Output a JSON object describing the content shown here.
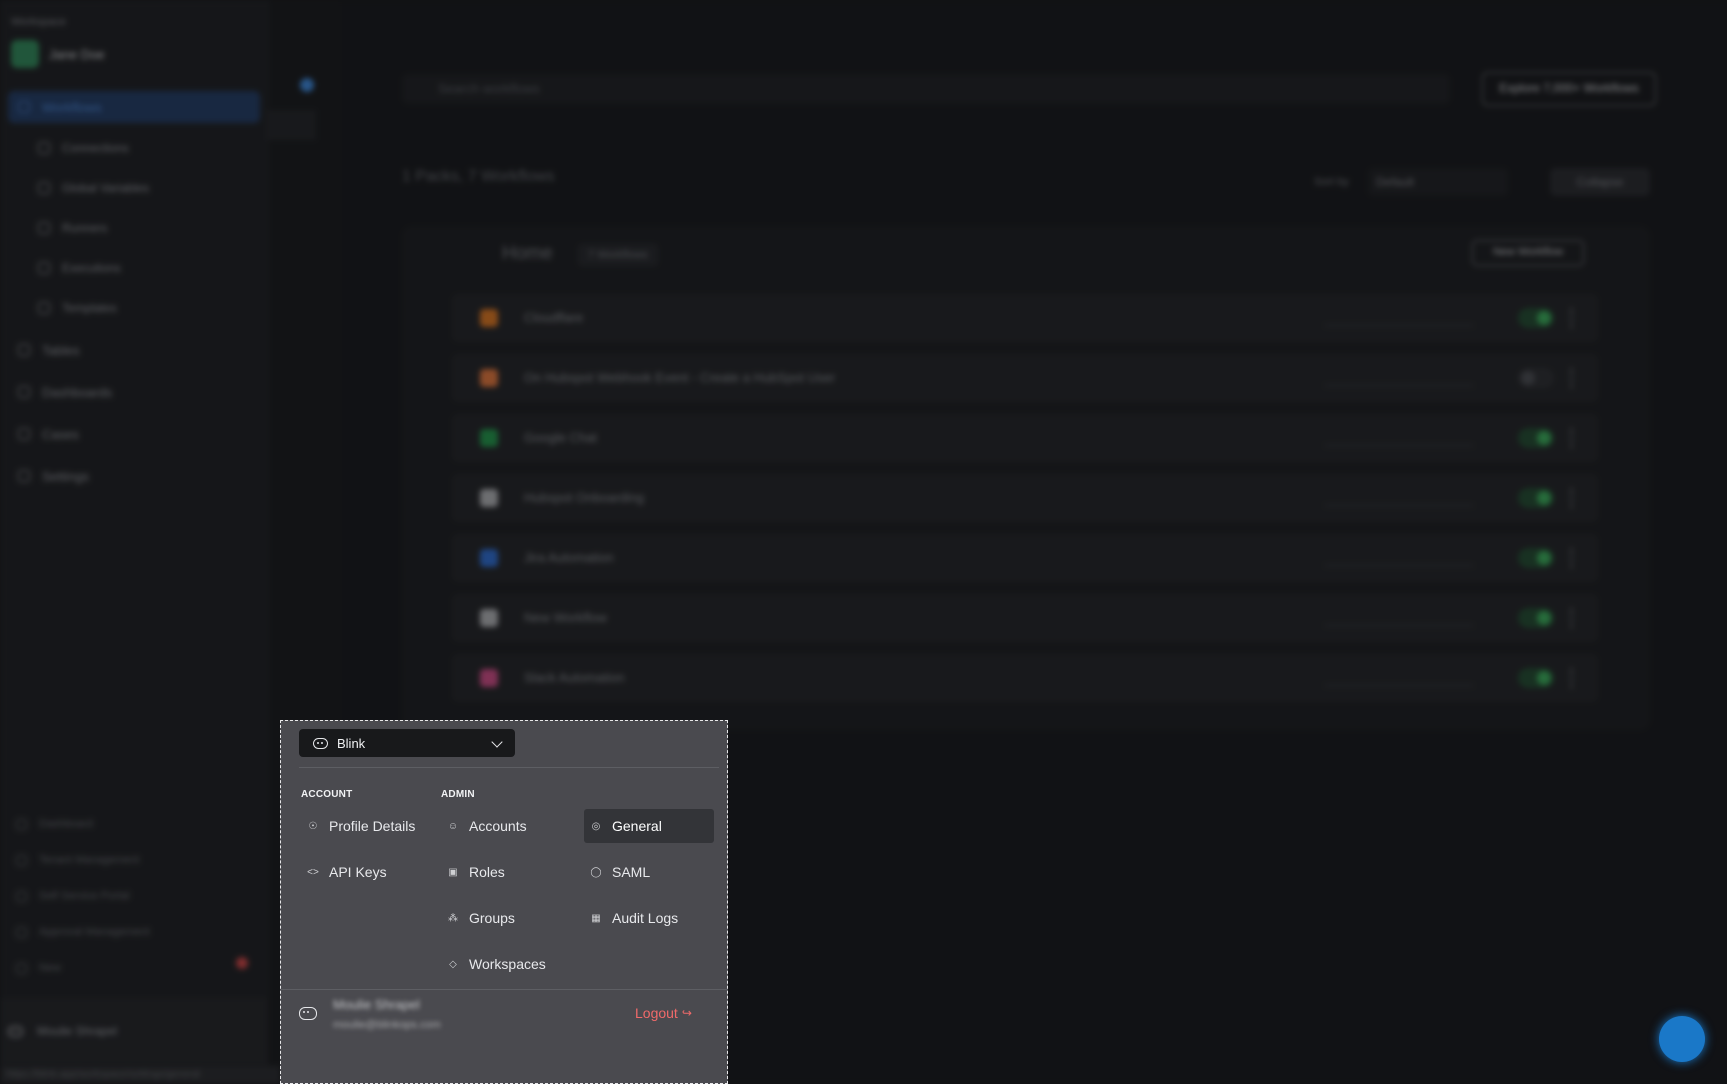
{
  "background": {
    "workspace_label": "Workspace",
    "workspace_name": "Jane Doe",
    "nav": [
      "Workflows",
      "Connections",
      "Global Variables",
      "Runners",
      "Executions",
      "Templates",
      "Tables",
      "Dashboards",
      "Cases",
      "Settings"
    ],
    "search_placeholder": "Search workflows",
    "explore_button": "Explore 7,000+ Workflows",
    "count_text": "1 Packs, 7 Workflows",
    "sort_label": "Sort by",
    "sort_value": "Default",
    "collapse_button": "Collapse",
    "pack_title": "Home",
    "pack_badge": "7 Workflows",
    "new_workflow_button": "New Workflow",
    "workflows": [
      {
        "name": "Cloudflare",
        "color": "#e8791d",
        "enabled": true
      },
      {
        "name": "On Hubspot Webhook Event - Create a HubSpot User",
        "color": "#f07a3a",
        "enabled": false
      },
      {
        "name": "Google Chat",
        "color": "#1e9c4a",
        "enabled": true
      },
      {
        "name": "Hubspot Onboarding",
        "color": "#b9babd",
        "enabled": true
      },
      {
        "name": "Jira Automation",
        "color": "#2b6fdc",
        "enabled": true
      },
      {
        "name": "New Workflow",
        "color": "#b9babd",
        "enabled": true
      },
      {
        "name": "Slack Automation",
        "color": "#d94b8a",
        "enabled": true
      }
    ],
    "bottom_nav": [
      "Dashboard",
      "Tenant Management",
      "Self Service Portal",
      "Approval Management",
      "New"
    ],
    "user_name": "Moulie Shrapel",
    "status_url": "https://blink.app/workspace/settings/general"
  },
  "panel": {
    "workspace_select": "Blink",
    "account_header": "ACCOUNT",
    "admin_header": "ADMIN",
    "account_items": [
      {
        "label": "Profile Details",
        "icon": "user-icon"
      },
      {
        "label": "API Keys",
        "icon": "code-icon"
      }
    ],
    "admin_col1": [
      {
        "label": "Accounts",
        "icon": "users-icon"
      },
      {
        "label": "Roles",
        "icon": "briefcase-icon"
      },
      {
        "label": "Groups",
        "icon": "group-icon"
      },
      {
        "label": "Workspaces",
        "icon": "diamond-icon"
      }
    ],
    "admin_col2": [
      {
        "label": "General",
        "icon": "target-icon",
        "active": true
      },
      {
        "label": "SAML",
        "icon": "shield-icon"
      },
      {
        "label": "Audit Logs",
        "icon": "log-icon"
      }
    ],
    "user_name": "Moulie Shrapel",
    "user_email": "moulie@blinkops.com",
    "logout_label": "Logout"
  }
}
